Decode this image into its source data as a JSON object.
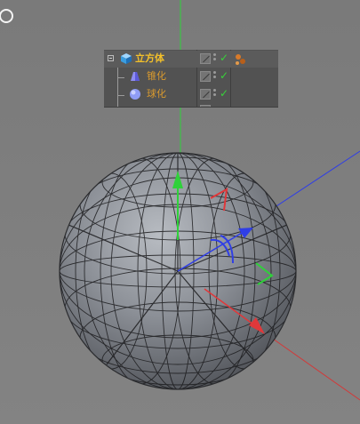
{
  "viewport": {
    "background": "#7d7d7d"
  },
  "object_manager": {
    "rows": [
      {
        "label": "立方体",
        "icon": "cube-icon",
        "checked": true,
        "tag": "material-tag-icon"
      },
      {
        "label": "锥化",
        "icon": "taper-deformer-icon",
        "checked": true
      },
      {
        "label": "球化",
        "icon": "spherify-deformer-icon",
        "checked": true
      }
    ],
    "check_glyph": "✓"
  },
  "scene": {
    "object": "sphere",
    "axis_colors": {
      "x": "#e0383a",
      "y": "#2fd13a",
      "z": "#2f3ee6"
    }
  }
}
